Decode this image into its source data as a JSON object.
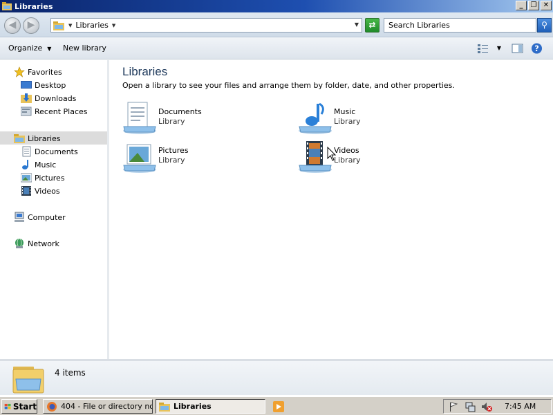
{
  "window": {
    "title": "Libraries"
  },
  "address_bar": {
    "breadcrumb": "Libraries",
    "search_placeholder": "Search Libraries"
  },
  "toolbar": {
    "organize_label": "Organize",
    "new_library_label": "New library"
  },
  "nav_pane": {
    "items": [
      {
        "label": "Favorites",
        "icon": "star-icon"
      },
      {
        "label": "Desktop",
        "icon": "desktop-icon"
      },
      {
        "label": "Downloads",
        "icon": "downloads-folder-icon"
      },
      {
        "label": "Recent Places",
        "icon": "recent-places-icon"
      },
      {
        "label": "Libraries",
        "icon": "libraries-icon",
        "selected": true
      },
      {
        "label": "Documents",
        "icon": "documents-icon"
      },
      {
        "label": "Music",
        "icon": "music-note-icon"
      },
      {
        "label": "Pictures",
        "icon": "pictures-icon"
      },
      {
        "label": "Videos",
        "icon": "film-icon"
      },
      {
        "label": "Computer",
        "icon": "computer-icon"
      },
      {
        "label": "Network",
        "icon": "network-icon"
      }
    ]
  },
  "content": {
    "heading": "Libraries",
    "subtitle": "Open a library to see your files and arrange them by folder, date, and other properties.",
    "libraries": [
      {
        "name": "Documents",
        "type": "Library",
        "icon": "documents-library-icon"
      },
      {
        "name": "Music",
        "type": "Library",
        "icon": "music-library-icon"
      },
      {
        "name": "Pictures",
        "type": "Library",
        "icon": "pictures-library-icon"
      },
      {
        "name": "Videos",
        "type": "Library",
        "icon": "videos-library-icon"
      }
    ]
  },
  "details_pane": {
    "item_count": "4 items"
  },
  "taskbar": {
    "start_label": "Start",
    "tasks": [
      {
        "label": "404 - File or directory no...",
        "icon": "firefox-icon",
        "active": false
      },
      {
        "label": "Libraries",
        "icon": "explorer-folder-icon",
        "active": true
      }
    ],
    "clock": "7:45 AM"
  },
  "colors": {
    "title_bar_start": "#0a246a",
    "title_bar_end": "#a6caf0",
    "heading": "#1e395b",
    "selection": "#dcdcdc",
    "taskbar": "#d4d0c8"
  }
}
